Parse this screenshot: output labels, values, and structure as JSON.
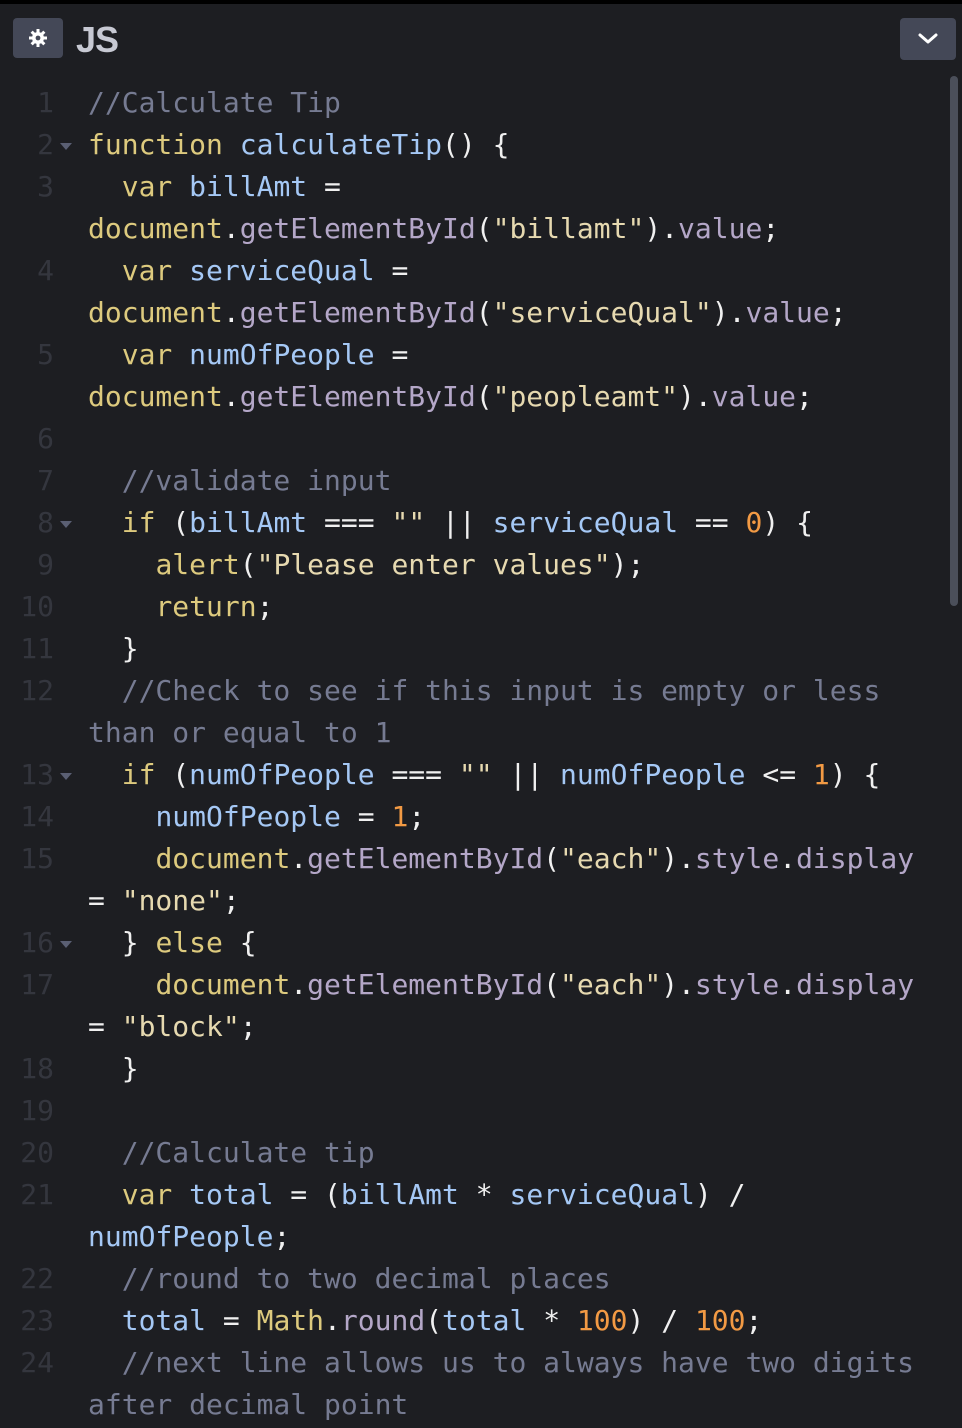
{
  "header": {
    "title": "JS",
    "settings_icon": "gear-icon",
    "collapse_icon": "chevron-down-icon"
  },
  "colors": {
    "background": "#1d1e22",
    "keyword": "#ddca7e",
    "variable": "#a5c8f5",
    "string": "#e6d9b0",
    "number": "#f29a44",
    "comment": "#767b92",
    "method": "#b4a7c8"
  },
  "code": {
    "lines": [
      {
        "n": "1",
        "fold": false,
        "wrapped": false,
        "tokens": [
          [
            "cm",
            "//Calculate Tip"
          ]
        ]
      },
      {
        "n": "2",
        "fold": true,
        "wrapped": false,
        "tokens": [
          [
            "k",
            "function"
          ],
          [
            "p",
            " "
          ],
          [
            "v",
            "calculateTip"
          ],
          [
            "p",
            "() {"
          ]
        ]
      },
      {
        "n": "3",
        "fold": false,
        "wrapped": false,
        "tokens": [
          [
            "p",
            "  "
          ],
          [
            "k",
            "var"
          ],
          [
            "p",
            " "
          ],
          [
            "v",
            "billAmt"
          ],
          [
            "p",
            " ="
          ]
        ]
      },
      {
        "n": "",
        "fold": false,
        "wrapped": true,
        "tokens": [
          [
            "k",
            "document"
          ],
          [
            "p",
            "."
          ],
          [
            "m",
            "getElementById"
          ],
          [
            "p",
            "("
          ],
          [
            "s",
            "\"billamt\""
          ],
          [
            "p",
            ")."
          ],
          [
            "m",
            "value"
          ],
          [
            "p",
            ";"
          ]
        ]
      },
      {
        "n": "4",
        "fold": false,
        "wrapped": false,
        "tokens": [
          [
            "p",
            "  "
          ],
          [
            "k",
            "var"
          ],
          [
            "p",
            " "
          ],
          [
            "v",
            "serviceQual"
          ],
          [
            "p",
            " ="
          ]
        ]
      },
      {
        "n": "",
        "fold": false,
        "wrapped": true,
        "tokens": [
          [
            "k",
            "document"
          ],
          [
            "p",
            "."
          ],
          [
            "m",
            "getElementById"
          ],
          [
            "p",
            "("
          ],
          [
            "s",
            "\"serviceQual\""
          ],
          [
            "p",
            ")."
          ],
          [
            "m",
            "value"
          ],
          [
            "p",
            ";"
          ]
        ]
      },
      {
        "n": "5",
        "fold": false,
        "wrapped": false,
        "tokens": [
          [
            "p",
            "  "
          ],
          [
            "k",
            "var"
          ],
          [
            "p",
            " "
          ],
          [
            "v",
            "numOfPeople"
          ],
          [
            "p",
            " ="
          ]
        ]
      },
      {
        "n": "",
        "fold": false,
        "wrapped": true,
        "tokens": [
          [
            "k",
            "document"
          ],
          [
            "p",
            "."
          ],
          [
            "m",
            "getElementById"
          ],
          [
            "p",
            "("
          ],
          [
            "s",
            "\"peopleamt\""
          ],
          [
            "p",
            ")."
          ],
          [
            "m",
            "value"
          ],
          [
            "p",
            ";"
          ]
        ]
      },
      {
        "n": "6",
        "fold": false,
        "wrapped": false,
        "tokens": []
      },
      {
        "n": "7",
        "fold": false,
        "wrapped": false,
        "tokens": [
          [
            "p",
            "  "
          ],
          [
            "cm",
            "//validate input"
          ]
        ]
      },
      {
        "n": "8",
        "fold": true,
        "wrapped": false,
        "tokens": [
          [
            "p",
            "  "
          ],
          [
            "k",
            "if"
          ],
          [
            "p",
            " ("
          ],
          [
            "v",
            "billAmt"
          ],
          [
            "p",
            " === "
          ],
          [
            "s",
            "\"\""
          ],
          [
            "p",
            " || "
          ],
          [
            "v",
            "serviceQual"
          ],
          [
            "p",
            " == "
          ],
          [
            "n",
            "0"
          ],
          [
            "p",
            ") {"
          ]
        ]
      },
      {
        "n": "9",
        "fold": false,
        "wrapped": false,
        "tokens": [
          [
            "p",
            "    "
          ],
          [
            "k",
            "alert"
          ],
          [
            "p",
            "("
          ],
          [
            "s",
            "\"Please enter values\""
          ],
          [
            "p",
            ");"
          ]
        ]
      },
      {
        "n": "10",
        "fold": false,
        "wrapped": false,
        "tokens": [
          [
            "p",
            "    "
          ],
          [
            "k",
            "return"
          ],
          [
            "p",
            ";"
          ]
        ]
      },
      {
        "n": "11",
        "fold": false,
        "wrapped": false,
        "tokens": [
          [
            "p",
            "  }"
          ]
        ]
      },
      {
        "n": "12",
        "fold": false,
        "wrapped": false,
        "tokens": [
          [
            "p",
            "  "
          ],
          [
            "cm",
            "//Check to see if this input is empty or less"
          ]
        ]
      },
      {
        "n": "",
        "fold": false,
        "wrapped": true,
        "tokens": [
          [
            "cm",
            "than or equal to 1"
          ]
        ]
      },
      {
        "n": "13",
        "fold": true,
        "wrapped": false,
        "tokens": [
          [
            "p",
            "  "
          ],
          [
            "k",
            "if"
          ],
          [
            "p",
            " ("
          ],
          [
            "v",
            "numOfPeople"
          ],
          [
            "p",
            " === "
          ],
          [
            "s",
            "\"\""
          ],
          [
            "p",
            " || "
          ],
          [
            "v",
            "numOfPeople"
          ],
          [
            "p",
            " <= "
          ],
          [
            "n",
            "1"
          ],
          [
            "p",
            ") {"
          ]
        ]
      },
      {
        "n": "14",
        "fold": false,
        "wrapped": false,
        "tokens": [
          [
            "p",
            "    "
          ],
          [
            "v",
            "numOfPeople"
          ],
          [
            "p",
            " = "
          ],
          [
            "n",
            "1"
          ],
          [
            "p",
            ";"
          ]
        ]
      },
      {
        "n": "15",
        "fold": false,
        "wrapped": false,
        "tokens": [
          [
            "p",
            "    "
          ],
          [
            "k",
            "document"
          ],
          [
            "p",
            "."
          ],
          [
            "m",
            "getElementById"
          ],
          [
            "p",
            "("
          ],
          [
            "s",
            "\"each\""
          ],
          [
            "p",
            ")."
          ],
          [
            "m",
            "style"
          ],
          [
            "p",
            "."
          ],
          [
            "m",
            "display"
          ]
        ]
      },
      {
        "n": "",
        "fold": false,
        "wrapped": true,
        "tokens": [
          [
            "p",
            "= "
          ],
          [
            "s",
            "\"none\""
          ],
          [
            "p",
            ";"
          ]
        ]
      },
      {
        "n": "16",
        "fold": true,
        "wrapped": false,
        "tokens": [
          [
            "p",
            "  } "
          ],
          [
            "k",
            "else"
          ],
          [
            "p",
            " {"
          ]
        ]
      },
      {
        "n": "17",
        "fold": false,
        "wrapped": false,
        "tokens": [
          [
            "p",
            "    "
          ],
          [
            "k",
            "document"
          ],
          [
            "p",
            "."
          ],
          [
            "m",
            "getElementById"
          ],
          [
            "p",
            "("
          ],
          [
            "s",
            "\"each\""
          ],
          [
            "p",
            ")."
          ],
          [
            "m",
            "style"
          ],
          [
            "p",
            "."
          ],
          [
            "m",
            "display"
          ]
        ]
      },
      {
        "n": "",
        "fold": false,
        "wrapped": true,
        "tokens": [
          [
            "p",
            "= "
          ],
          [
            "s",
            "\"block\""
          ],
          [
            "p",
            ";"
          ]
        ]
      },
      {
        "n": "18",
        "fold": false,
        "wrapped": false,
        "tokens": [
          [
            "p",
            "  }"
          ]
        ]
      },
      {
        "n": "19",
        "fold": false,
        "wrapped": false,
        "tokens": []
      },
      {
        "n": "20",
        "fold": false,
        "wrapped": false,
        "tokens": [
          [
            "p",
            "  "
          ],
          [
            "cm",
            "//Calculate tip"
          ]
        ]
      },
      {
        "n": "21",
        "fold": false,
        "wrapped": false,
        "tokens": [
          [
            "p",
            "  "
          ],
          [
            "k",
            "var"
          ],
          [
            "p",
            " "
          ],
          [
            "v",
            "total"
          ],
          [
            "p",
            " = ("
          ],
          [
            "v",
            "billAmt"
          ],
          [
            "p",
            " * "
          ],
          [
            "v",
            "serviceQual"
          ],
          [
            "p",
            ") /"
          ]
        ]
      },
      {
        "n": "",
        "fold": false,
        "wrapped": true,
        "tokens": [
          [
            "v",
            "numOfPeople"
          ],
          [
            "p",
            ";"
          ]
        ]
      },
      {
        "n": "22",
        "fold": false,
        "wrapped": false,
        "tokens": [
          [
            "p",
            "  "
          ],
          [
            "cm",
            "//round to two decimal places"
          ]
        ]
      },
      {
        "n": "23",
        "fold": false,
        "wrapped": false,
        "tokens": [
          [
            "p",
            "  "
          ],
          [
            "v",
            "total"
          ],
          [
            "p",
            " = "
          ],
          [
            "k",
            "Math"
          ],
          [
            "p",
            "."
          ],
          [
            "m",
            "round"
          ],
          [
            "p",
            "("
          ],
          [
            "v",
            "total"
          ],
          [
            "p",
            " * "
          ],
          [
            "n",
            "100"
          ],
          [
            "p",
            ") / "
          ],
          [
            "n",
            "100"
          ],
          [
            "p",
            ";"
          ]
        ]
      },
      {
        "n": "24",
        "fold": false,
        "wrapped": false,
        "tokens": [
          [
            "p",
            "  "
          ],
          [
            "cm",
            "//next line allows us to always have two digits"
          ]
        ]
      },
      {
        "n": "",
        "fold": false,
        "wrapped": true,
        "tokens": [
          [
            "cm",
            "after decimal point"
          ]
        ]
      }
    ]
  }
}
